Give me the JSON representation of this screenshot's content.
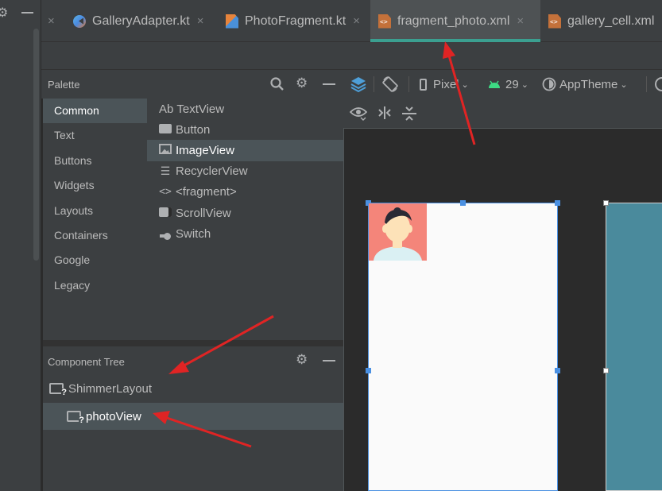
{
  "tabs": [
    {
      "label": "GalleryAdapter.kt",
      "icon": "kotlin-file-icon",
      "active": false
    },
    {
      "label": "PhotoFragment.kt",
      "icon": "kotlin-class-icon",
      "active": false
    },
    {
      "label": "fragment_photo.xml",
      "icon": "layout-xml-icon",
      "active": true
    },
    {
      "label": "gallery_cell.xml",
      "icon": "layout-xml-icon",
      "active": false
    }
  ],
  "tab_close_glyph": "×",
  "palette": {
    "title": "Palette",
    "categories": [
      "Common",
      "Text",
      "Buttons",
      "Widgets",
      "Layouts",
      "Containers",
      "Google",
      "Legacy"
    ],
    "selected_category": "Common",
    "items": [
      {
        "prefix": "Ab",
        "label": "TextView",
        "icon": "textview-icon"
      },
      {
        "prefix": "",
        "label": "Button",
        "icon": "button-icon"
      },
      {
        "prefix": "",
        "label": "ImageView",
        "icon": "imageview-icon"
      },
      {
        "prefix": "",
        "label": "RecyclerView",
        "icon": "recyclerview-icon"
      },
      {
        "prefix": "",
        "label": "<fragment>",
        "icon": "fragment-icon"
      },
      {
        "prefix": "",
        "label": "ScrollView",
        "icon": "scrollview-icon"
      },
      {
        "prefix": "",
        "label": "Switch",
        "icon": "switch-icon"
      }
    ],
    "selected_item": "ImageView"
  },
  "component_tree": {
    "title": "Component Tree",
    "nodes": [
      {
        "label": "ShimmerLayout",
        "depth": 0,
        "selected": false
      },
      {
        "label": "photoView",
        "depth": 1,
        "selected": true
      }
    ]
  },
  "design_toolbar": {
    "device": "Pixel",
    "api_level": "29",
    "theme": "AppTheme"
  },
  "colors": {
    "accent_underline": "#3b9f90",
    "annotation_arrow": "#e02424",
    "design_surface": "#fafafa",
    "blueprint_surface": "#4a8a9c",
    "selection_outline": "#4a90e2"
  }
}
